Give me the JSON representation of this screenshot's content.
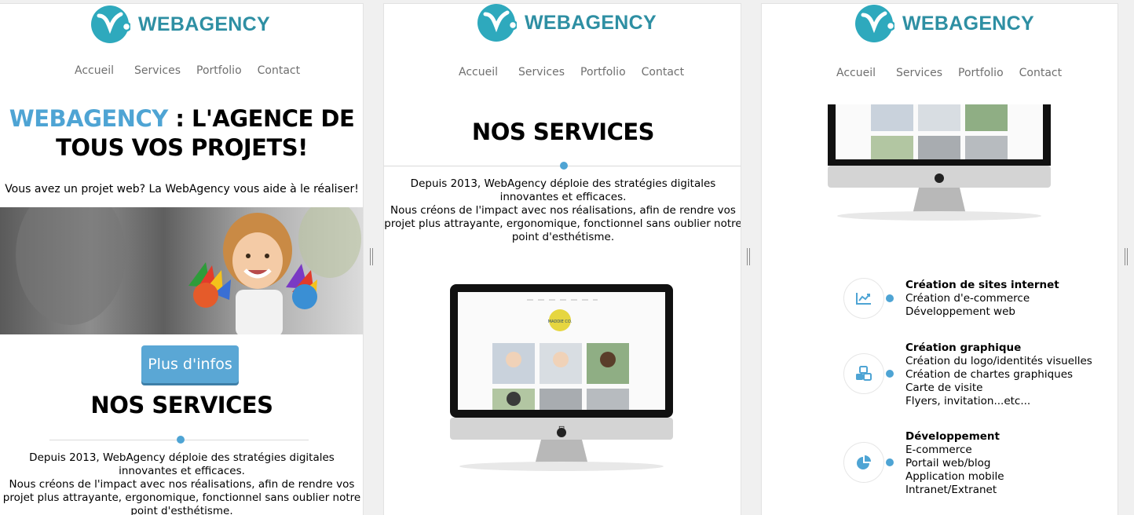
{
  "brand": {
    "name": "WEBAGENCY",
    "color": "#2e8fa3",
    "accent": "#4ea4d4"
  },
  "nav": [
    "Accueil",
    "Services",
    "Portfolio",
    "Contact"
  ],
  "hero": {
    "brand": "WEBAGENCY",
    "title_rest": " : L'AGENCE DE TOUS VOS PROJETS!",
    "subtitle": "Vous avez un projet web? La WebAgency vous aide à le réaliser!",
    "button": "Plus d'infos"
  },
  "services": {
    "title": "NOS SERVICES",
    "desc1": "Depuis 2013, WebAgency déploie des stratégies digitales innovantes et efficaces.",
    "desc2": "Nous créons de l'impact avec nos réalisations, afin de rendre vos projet plus attrayante, ergonomique, fonctionnel sans oublier notre point d'esthétisme.",
    "screen_logo_text": "MADDIE CO."
  },
  "service_items": [
    {
      "icon": "chart-icon",
      "title": "Création de sites internet",
      "lines": [
        "Création d'e-commerce",
        "Développement web"
      ]
    },
    {
      "icon": "cubes-icon",
      "title": "Création graphique",
      "lines": [
        "Création du logo/identités visuelles",
        "Création de chartes graphiques",
        "Carte de visite",
        "Flyers, invitation...etc..."
      ]
    },
    {
      "icon": "pie-chart-icon",
      "title": "Développement",
      "lines": [
        "E-commerce",
        "Portail web/blog",
        "Application mobile",
        "Intranet/Extranet"
      ]
    }
  ]
}
